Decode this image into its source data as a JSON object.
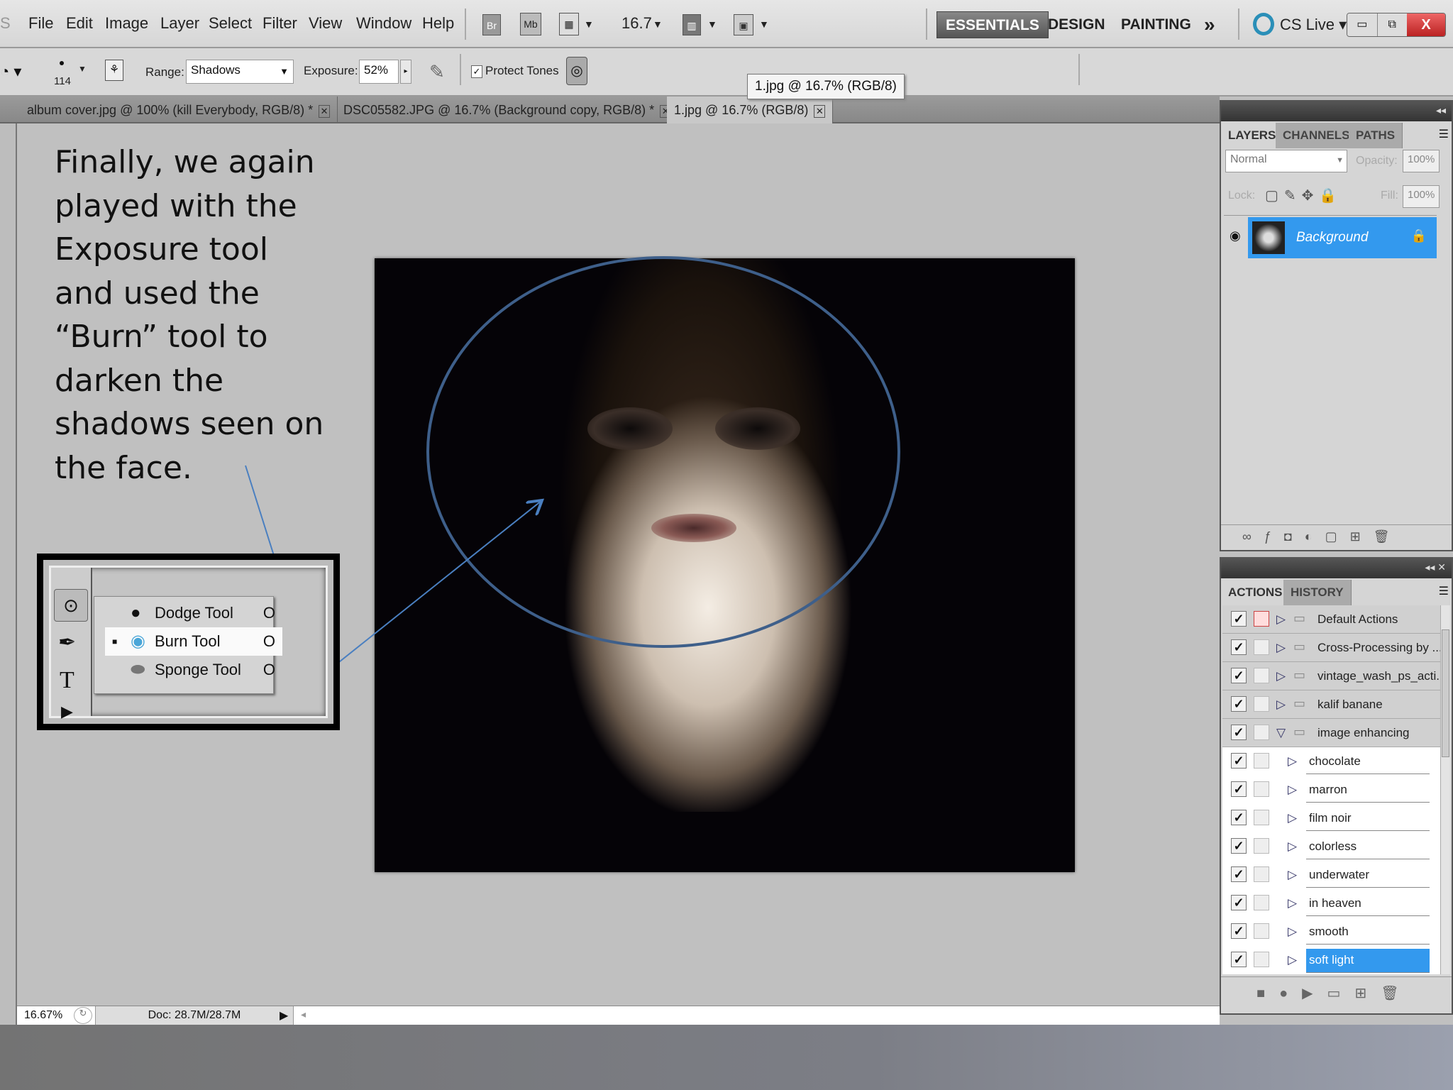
{
  "menubar": {
    "logo": "S",
    "items": [
      "File",
      "Edit",
      "Image",
      "Layer",
      "Select",
      "Filter",
      "View",
      "Window",
      "Help"
    ],
    "br": "Br",
    "mb": "Mb",
    "zoom": "16.7",
    "workspaces": [
      "ESSENTIALS",
      "DESIGN",
      "PAINTING"
    ],
    "more": "»",
    "cslive": "CS Live",
    "win_close": "X"
  },
  "options": {
    "brush_size": "114",
    "range_label": "Range:",
    "range_value": "Shadows",
    "exposure_label": "Exposure:",
    "exposure_value": "52%",
    "protect_tones": "Protect Tones"
  },
  "tabs": [
    {
      "label": "album cover.jpg @ 100% (kill Everybody, RGB/8) *"
    },
    {
      "label": "DSC05582.JPG @ 16.7% (Background copy, RGB/8) *"
    },
    {
      "label": "1.jpg @ 16.7% (RGB/8)"
    }
  ],
  "tooltip": "1.jpg @ 16.7% (RGB/8)",
  "slide_text": [
    "Finally, we again",
    "played with the",
    "Exposure tool",
    "and used the",
    "“Burn” tool to",
    "darken the",
    "shadows seen on",
    "the face."
  ],
  "tool_popup": [
    {
      "label": "Dodge Tool",
      "key": "O"
    },
    {
      "label": "Burn Tool",
      "key": "O",
      "selected": true
    },
    {
      "label": "Sponge Tool",
      "key": "O"
    }
  ],
  "layers": {
    "tabs": [
      "LAYERS",
      "CHANNELS",
      "PATHS"
    ],
    "blend": "Normal",
    "opacity_label": "Opacity:",
    "opacity": "100%",
    "lock_label": "Lock:",
    "fill_label": "Fill:",
    "fill": "100%",
    "layer_name": "Background",
    "highlight": "#3399ee"
  },
  "actions": {
    "tabs": [
      "ACTIONS",
      "HISTORY"
    ],
    "sets": [
      "Default Actions",
      "Cross-Processing by ...",
      "vintage_wash_ps_acti...",
      "kalif banane",
      "image enhancing"
    ],
    "items": [
      "chocolate",
      "marron",
      "film noir",
      "colorless",
      "underwater",
      "in heaven",
      "smooth",
      "soft light"
    ],
    "selected": "soft light"
  },
  "status": {
    "zoom": "16.67%",
    "doc": "Doc: 28.7M/28.7M"
  }
}
